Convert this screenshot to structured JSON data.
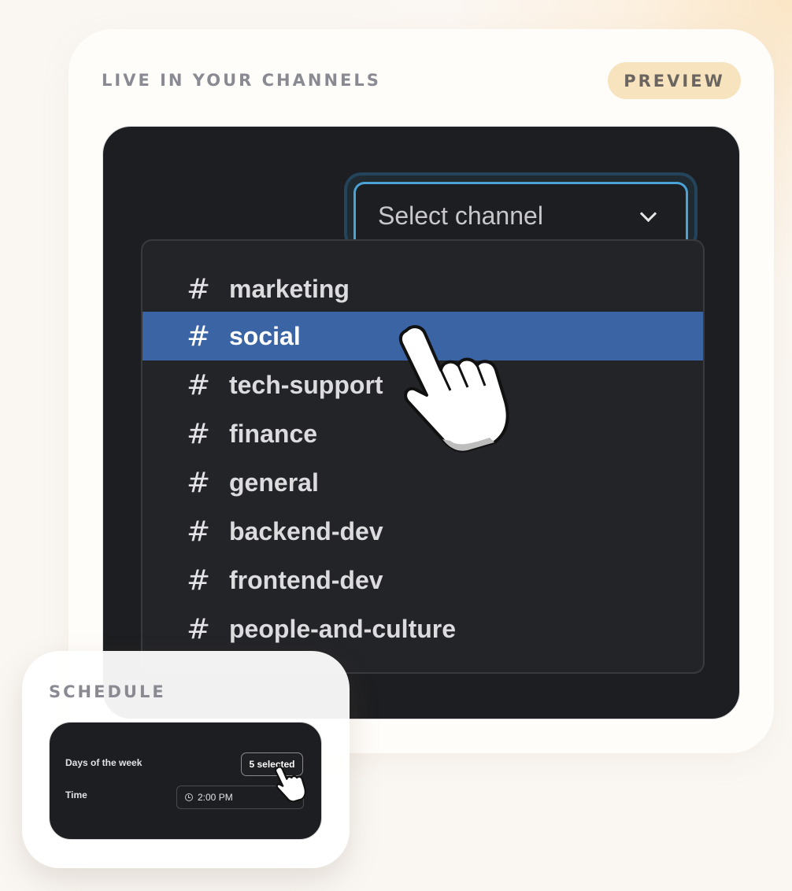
{
  "channels_card": {
    "section_title": "LIVE IN YOUR CHANNELS",
    "badge": "PREVIEW",
    "select": {
      "placeholder": "Select channel",
      "icon": "chevron-down-icon"
    },
    "dropdown": {
      "hash_symbol": "#",
      "selected_index": 1,
      "items": [
        {
          "label": "marketing"
        },
        {
          "label": "social"
        },
        {
          "label": "tech-support"
        },
        {
          "label": "finance"
        },
        {
          "label": "general"
        },
        {
          "label": "backend-dev"
        },
        {
          "label": "frontend-dev"
        },
        {
          "label": "people-and-culture"
        }
      ]
    }
  },
  "schedule_card": {
    "title": "SCHEDULE",
    "days_label": "Days of the week",
    "days_value": "5 selected",
    "time_label": "Time",
    "time_value": "2:00 PM",
    "time_icon": "clock-icon"
  },
  "colors": {
    "panel_bg": "#1d1e21",
    "selected_row": "#3a64a4",
    "focus_border": "#4aa3d4",
    "badge_bg": "#f7e3bd"
  }
}
